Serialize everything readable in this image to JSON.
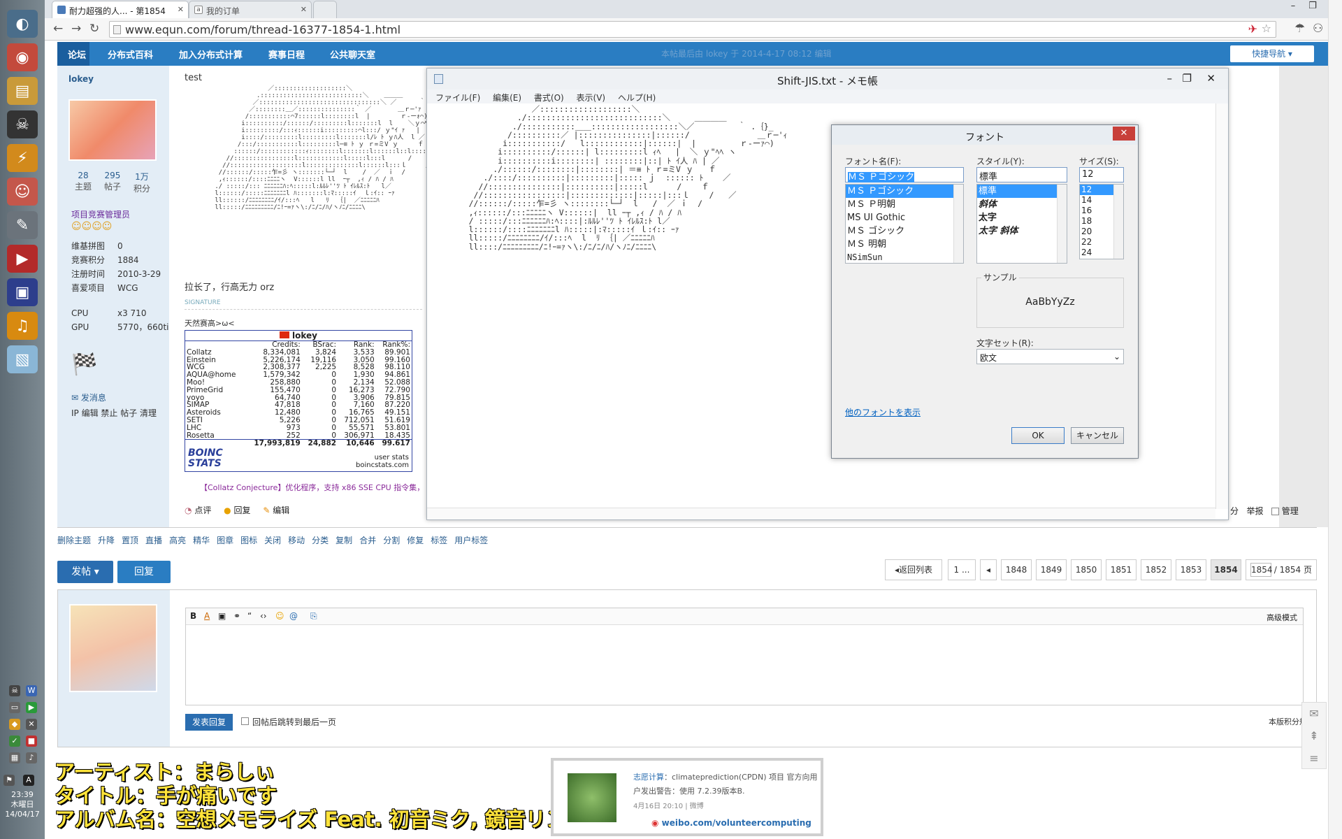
{
  "desktop": {
    "clock_time": "23:39",
    "clock_day": "木曜日",
    "clock_date": "14/04/17"
  },
  "browser": {
    "tabs": [
      {
        "title": "耐力超强的人... - 第1854"
      },
      {
        "title": "我的订单"
      }
    ],
    "url": "www.equn.com/forum/thread-16377-1854-1.html"
  },
  "forum": {
    "nav": [
      "论坛",
      "分布式百科",
      "加入分布式计算",
      "赛事日程",
      "公共聊天室"
    ],
    "quick_nav": "快捷导航",
    "faded_notice": "本帖最后由 lokey 于 2014-4-17 08:12 编辑",
    "user": {
      "name": "lokey",
      "stats": [
        {
          "n": "28",
          "l": "主题"
        },
        {
          "n": "295",
          "l": "帖子"
        },
        {
          "n": "1万",
          "l": "积分"
        }
      ],
      "group": "项目竞赛管理员",
      "info": [
        {
          "k": "维基拼图",
          "v": "0"
        },
        {
          "k": "竞赛积分",
          "v": "1884"
        },
        {
          "k": "注册时间",
          "v": "2010-3-29"
        },
        {
          "k": "喜爱项目",
          "v": "WCG"
        },
        {
          "k": "CPU",
          "v": "x3 710"
        },
        {
          "k": "GPU",
          "v": "5770，660ti"
        }
      ],
      "send_msg": "发消息",
      "admin_links": "IP 编辑 禁止 帖子 清理"
    },
    "post": {
      "first_line": "test",
      "ascii_art": "                      ／:::::::::::::::::::＼\n                   .:::::::::::::::::::::::::::＼    ＿＿＿\n                  ／::::::::::::::::::::::::::::::::＼ ／      ｀ .｛}_\n                 ／::::::::＿／:::::::::::::::｀ ／       ＿ｒ─'ｧ\n                /:::::::::::⌒7::::::l::::::::l  |        ｒ‐ーｫ⌒)\n               i::::::::::/::::::/:::::::::l:::::::l  l    ＼ｙ⌒ﾍﾍヽ\n               i:::::::::/:::ｨ::::::i:::::::::⌒l:::/ ｙ\"ｲ ｧ   |\n               i::::/:::::::::l:::::::::l:::::::l/ﾚ ﾄ ｙﾊ人  l ／\n              /:::/:::::::::::l:::::::::l─≡ ﾄ ｙ ｒ=ミV ｙ     ｆ\n             ::::::/::::::::::::ｨ::::::::l:::::::l::::::l::l::::: ﾄ    ／\n           //::::::::::::::::l::::::::::::l:::::l:::l      /    ｆ\n          //:::::::::::::::::::l::::::::::::::l::::::l:::ｌ     /    ／\n         //::::::/:::::乍=彡 ヽ:::::::└─┘  l    /  ／  ｉ  /\n         ,ｨ::::::/::::ﾆﾆﾆﾆヽ  V::::::l ll  ｰ┬  ,ｨ / ﾊ / ﾊ\n        ./ :::::/::: ﾆﾆﾆﾆﾆﾆﾊ:ﾍ:::::l:ﾙﾙﾚ''ﾂ ﾄ ｲﾚﾙｽ:ﾄ   l／\n        l::::::/:::::ﾆﾆﾆﾆﾆﾆﾆl ﾊ:::::::l:ﾏ:::::ｲ  ｌ:ｲ:: ｰｧ\n        ll::::::/ﾆﾆﾆﾆﾆﾆﾆﾆ/ｲ/:::ﾍ   l   ﾘ  ｛|  ／ﾆﾆﾆﾆﾆﾊ\n        ll:::::/ﾆﾆﾆﾆﾆﾆﾆﾆﾆ/ﾆ!ｰ=ｧヽ\\:/ﾆ/ﾆ/ﾊ/ヽﾉﾆ/ﾆﾆﾆﾆ\\",
      "comment": "拉长了，行高无力 orz",
      "signature_label": "SIGNATURE",
      "signature_text": "天然赛高>ω<",
      "actions": [
        "点评",
        "回复",
        "编辑"
      ],
      "collatz": "【Collatz Conjecture】优化程序，支持 x86 SSE CPU 指令集，",
      "right_actions": [
        "分",
        "举报",
        "管理"
      ]
    },
    "boinc": {
      "user": "lokey",
      "headers": [
        "Credits:",
        "BSrac:",
        "Rank:",
        "Rank%:"
      ],
      "rows": [
        [
          "Collatz",
          "8,334,081",
          "3,824",
          "3,533",
          "89.901"
        ],
        [
          "Einstein",
          "5,226,174",
          "19,116",
          "3,050",
          "99.160"
        ],
        [
          "WCG",
          "2,308,377",
          "2,225",
          "8,528",
          "98.110"
        ],
        [
          "AQUA@home",
          "1,579,342",
          "0",
          "1,930",
          "94.861"
        ],
        [
          "Moo!",
          "258,880",
          "0",
          "2,134",
          "52.088"
        ],
        [
          "PrimeGrid",
          "155,470",
          "0",
          "16,273",
          "72.790"
        ],
        [
          "yoyo",
          "64,740",
          "0",
          "3,906",
          "79.815"
        ],
        [
          "SIMAP",
          "47,818",
          "0",
          "7,160",
          "87.220"
        ],
        [
          "Asteroids",
          "12,480",
          "0",
          "16,765",
          "49.151"
        ],
        [
          "SETI",
          "5,226",
          "0",
          "712,051",
          "51.619"
        ],
        [
          "LHC",
          "973",
          "0",
          "55,571",
          "53.801"
        ],
        [
          "Rosetta",
          "252",
          "0",
          "306,971",
          "18.435"
        ]
      ],
      "total": [
        "17,993,819",
        "24,882",
        "10,646",
        "99.617"
      ],
      "footer1": "user stats",
      "footer2": "boincstats.com",
      "logo": "BOINC STATS"
    },
    "mod_links": [
      "删除主题",
      "升降",
      "置顶",
      "直播",
      "高亮",
      "精华",
      "图章",
      "图标",
      "关闭",
      "移动",
      "分类",
      "复制",
      "合并",
      "分割",
      "修复",
      "标签",
      "用户标签"
    ],
    "post_btn": "发帖",
    "reply_btn": "回复",
    "pagination": {
      "back": "返回列表",
      "first": "1 ...",
      "pages": [
        "1848",
        "1849",
        "1850",
        "1851",
        "1852",
        "1853",
        "1854"
      ],
      "current_input": "1854",
      "total": "/ 1854 页"
    },
    "editor": {
      "advanced": "高级模式",
      "submit": "发表回复",
      "jump_label": "回帖后跳转到最后一页",
      "score_rules": "本版积分规则"
    }
  },
  "notepad": {
    "title": "Shift-JIS.txt - メモ帳",
    "menu": [
      "ファイル(F)",
      "編集(E)",
      "書式(O)",
      "表示(V)",
      "ヘルプ(H)"
    ],
    "ascii_art": "                  ／:::::::::::::::::::＼\n               ./::::::::::::::::::::::::::::＼     ＿＿＿＿\n              ./:::::::::::＿＿::::::::::::::::::＼／         ｀ .｛}_\n             /::::::::::／ |:::::::::::::::|::::::/              ＿ｒ─'ｨ\n            i:::::::::::/   l::::::::::::|::::::|  |         ｒ‐ーｧ⌒)\n           i::::::::::/::::::| l:::::::::l ｨﾍ   |  ＼ ｙ\"ﾍﾍ ヽ\n           i::::::::::i::::::::| ::::::::|::| ﾄ ｲ人 ﾊ | ／\n          ./::::::/::::::::|::::::::| ＝≡ ﾄ ｒ=ミV ｙ   ｆ\n        ./::::/::::::::::|:::::::::|::::: ｊ  :::::: ﾄ    ／\n       //:::::::::::::::|::::::::::|:::::l      /    ｆ\n      //:::::::::::::::::|:::::::::::::|:::::|:::ｌ    /   ／\n     //::::::/:::::乍=彡 ヽ::::::::└─┘  l   /  ／ ｉ  /\n     ,ｨ::::::/:::ﾆﾆﾆﾆﾆヽ V::::::|  ll ｰ┬ ,ｨ / ﾊ / ﾊ\n     / :::::/:::ﾆﾆﾆﾆﾆﾆﾊ:ﾍ::::|:ﾙﾙﾚ''ﾂ ﾄ ｲﾚﾙｽ:ﾄ l／\n     l::::::/::::ﾆﾆﾆﾆﾆﾆﾆl ﾊ:::::|:ﾏ:::::ｲ ｌ:ｲ:: ｰｧ\n     ll:::::/ﾆﾆﾆﾆﾆﾆﾆﾆ/ｲ/:::ﾍ  l  ﾘ ｛| ／ﾆﾆﾆﾆﾆﾊ\n     ll::::/ﾆﾆﾆﾆﾆﾆﾆﾆﾆ/ﾆ!ｰ=ｧヽ\\:/ﾆ/ﾆ/ﾊ/ヽﾉﾆ/ﾆﾆﾆﾆ\\"
  },
  "font_dialog": {
    "title": "フォント",
    "name_label": "フォント名(F):",
    "name_value": "ＭＳ Ｐゴシック",
    "names": [
      "ＭＳ Ｐゴシック",
      "ＭＳ Ｐ明朝",
      "MS UI Gothic",
      "ＭＳ ゴシック",
      "ＭＳ 明朝",
      "NSimSun"
    ],
    "style_label": "スタイル(Y):",
    "style_value": "標準",
    "styles": [
      "標準",
      "斜体",
      "太字",
      "太字 斜体"
    ],
    "size_label": "サイズ(S):",
    "size_value": "12",
    "sizes": [
      "12",
      "14",
      "16",
      "18",
      "20",
      "22",
      "24"
    ],
    "sample_label": "サンプル",
    "sample_text": "AaBbYyZz",
    "charset_label": "文字セット(R):",
    "charset_value": "欧文",
    "more_fonts": "他のフォントを表示",
    "ok": "OK",
    "cancel": "キャンセル"
  },
  "lyrics": {
    "artist": "アーティスト：まらしぃ",
    "title": "タイトル：手が痛いです",
    "album": "アルバム名：空想メモライズ Feat. 初音ミク, 鏡音リン"
  },
  "weibo": {
    "prefix": "志愿计算",
    "text": "：climateprediction(CPDN) 项目 官方向用户发出警告：使用 7.2.39版本B.",
    "time": "4月16日 20:10 | 微博",
    "link": "weibo.com/volunteercomputing"
  }
}
